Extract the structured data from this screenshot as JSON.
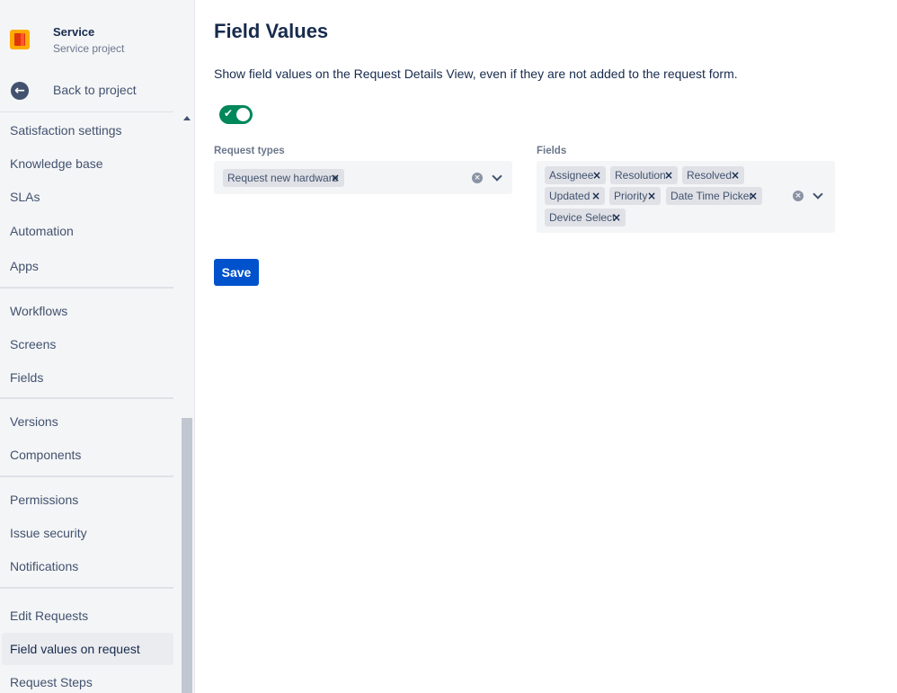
{
  "project": {
    "name": "Service",
    "type": "Service project"
  },
  "sidebar": {
    "back_label": "Back to project",
    "items": [
      {
        "label": "Satisfaction settings"
      },
      {
        "label": "Knowledge base"
      },
      {
        "label": "SLAs"
      },
      {
        "label": "Automation"
      },
      {
        "label": "Apps"
      },
      {
        "label": "Workflows"
      },
      {
        "label": "Screens"
      },
      {
        "label": "Fields"
      },
      {
        "label": "Versions"
      },
      {
        "label": "Components"
      },
      {
        "label": "Permissions"
      },
      {
        "label": "Issue security"
      },
      {
        "label": "Notifications"
      },
      {
        "label": "Edit Requests"
      },
      {
        "label": "Field values on request",
        "active": true
      },
      {
        "label": "Request Steps"
      }
    ]
  },
  "main": {
    "title": "Field Values",
    "description": "Show field values on the Request Details View, even if they are not added to the request form.",
    "toggle_on": true,
    "request_types": {
      "label": "Request types",
      "tags": [
        "Request new hardware"
      ]
    },
    "fields": {
      "label": "Fields",
      "tags": [
        "Assignee",
        "Resolution",
        "Resolved",
        "Updated",
        "Priority",
        "Date Time Picker",
        "Device Select"
      ]
    },
    "save_label": "Save"
  },
  "colors": {
    "primary": "#0052cc",
    "toggle_on": "#00875a",
    "sidebar_bg": "#f4f5f7"
  }
}
